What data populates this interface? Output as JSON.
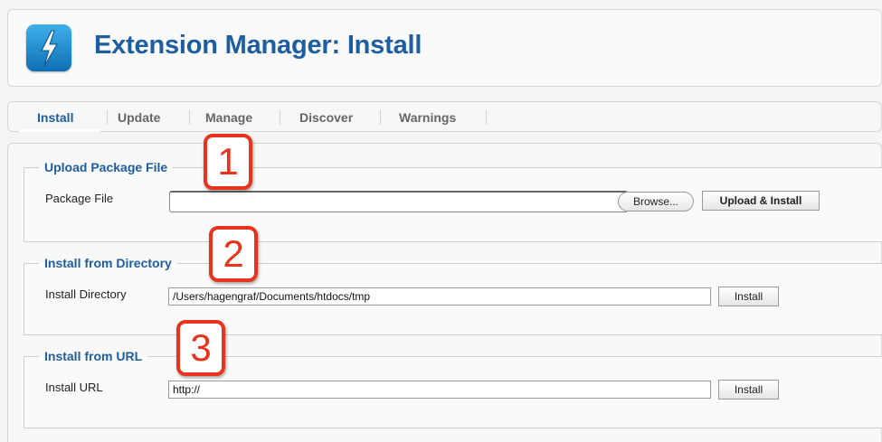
{
  "header": {
    "title": "Extension Manager: Install",
    "icon": "lightning-bolt-icon",
    "icon_color": "#1a8fd6"
  },
  "tabs": [
    {
      "label": "Install",
      "active": true
    },
    {
      "label": "Update",
      "active": false
    },
    {
      "label": "Manage",
      "active": false
    },
    {
      "label": "Discover",
      "active": false
    },
    {
      "label": "Warnings",
      "active": false
    }
  ],
  "upload": {
    "legend": "Upload Package File",
    "field_label": "Package File",
    "file_value": "",
    "browse_label": "Browse...",
    "submit_label": "Upload & Install"
  },
  "directory": {
    "legend": "Install from Directory",
    "field_label": "Install Directory",
    "value": "/Users/hagengraf/Documents/htdocs/tmp",
    "submit_label": "Install"
  },
  "url": {
    "legend": "Install from URL",
    "field_label": "Install URL",
    "value": "http://",
    "submit_label": "Install"
  },
  "callouts": [
    "1",
    "2",
    "3"
  ],
  "colors": {
    "accent": "#1d5ea0",
    "callout": "#e8341c"
  }
}
